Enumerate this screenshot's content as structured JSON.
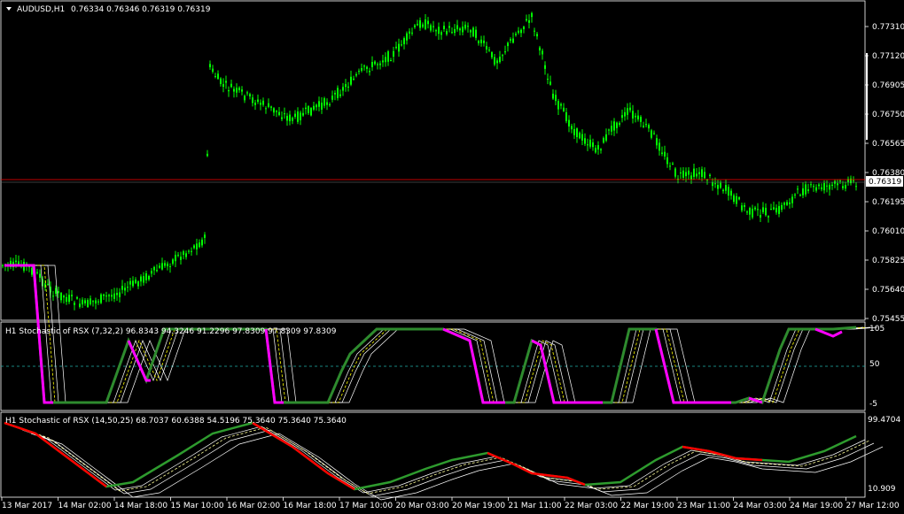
{
  "main_panel": {
    "symbol_label": "AUDUSD,H1",
    "ohlc": "0.76334 0.76346 0.76319 0.76319",
    "current_price": "0.76319",
    "price_axis": [
      "0.77310",
      "0.77120",
      "0.76905",
      "0.76750",
      "0.76565",
      "0.76380",
      "0.76195",
      "0.76010",
      "0.75825",
      "0.75640",
      "0.75455"
    ],
    "colors": {
      "candle": "#00ff00",
      "price_line": "#ff0000",
      "tag_bg": "#ffffff"
    }
  },
  "indicator_1": {
    "title": "H1 Stochastic of RSX (7,32,2) 96.8343 94.3246 91.2296 97.8309 97.8309 97.8309",
    "axis": [
      "105",
      "50",
      "-5"
    ],
    "level_50": 50,
    "colors": {
      "up": "#2e8b2e",
      "down": "#ff00ff",
      "band": "#ffffff",
      "signal": "#ffff00",
      "level": "#20b2aa"
    }
  },
  "indicator_2": {
    "title": "H1 Stochastic of RSX (14,50,25) 68.7037 60.6388 54.5196 75.3640 75.3640 75.3640",
    "axis": [
      "99.4704",
      "10.909"
    ],
    "colors": {
      "up": "#2e9b2e",
      "down": "#ff0000",
      "band": "#ffffff",
      "signal": "#ffff99"
    }
  },
  "time_axis": [
    "13 Mar 2017",
    "14 Mar 02:00",
    "14 Mar 18:00",
    "15 Mar 10:00",
    "16 Mar 02:00",
    "16 Mar 18:00",
    "17 Mar 10:00",
    "20 Mar 03:00",
    "20 Mar 19:00",
    "21 Mar 11:00",
    "22 Mar 03:00",
    "22 Mar 19:00",
    "23 Mar 11:00",
    "24 Mar 03:00",
    "24 Mar 19:00",
    "27 Mar 12:00"
  ]
}
